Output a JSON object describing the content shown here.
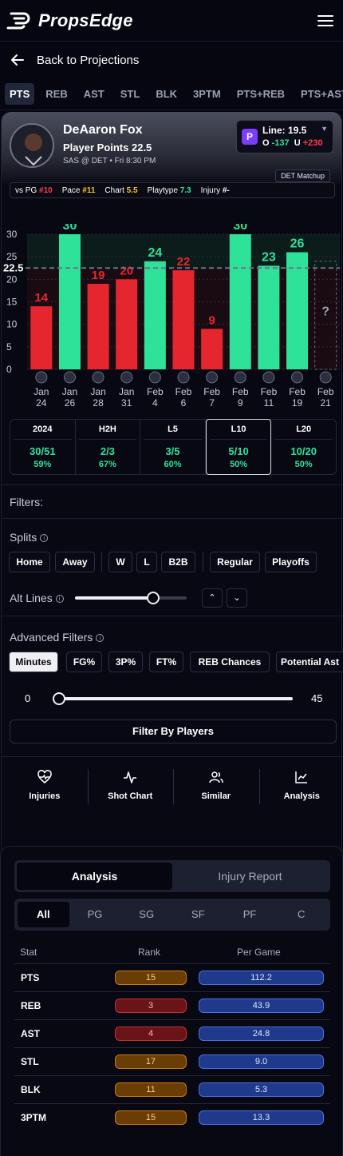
{
  "app": {
    "brand": "PropsEdge"
  },
  "nav": {
    "back_label": "Back to Projections"
  },
  "stat_tabs": [
    "PTS",
    "REB",
    "AST",
    "STL",
    "BLK",
    "3PTM",
    "PTS+REB",
    "PTS+AST"
  ],
  "player": {
    "name": "DeAaron Fox",
    "prop": "Player Points 22.5",
    "game": "SAS @ DET  •  Fri 8:30 PM",
    "line_label": "Line: 19.5",
    "over_label": "O",
    "over_odds": "-137",
    "under_label": "U",
    "under_odds": "+230",
    "matchup_badge": "DET Matchup",
    "book_letter": "P"
  },
  "strip": {
    "vs_pg_label": "vs PG",
    "vs_pg_value": "#10",
    "pace_label": "Pace",
    "pace_value": "#11",
    "chart_label": "Chart",
    "chart_value": "5.5",
    "playtype_label": "Playtype",
    "playtype_value": "7.3",
    "injury_label": "Injury",
    "injury_value": "#-"
  },
  "chart_data": {
    "type": "bar",
    "categories": [
      "Jan 24",
      "Jan 26",
      "Jan 28",
      "Jan 31",
      "Feb 4",
      "Feb 6",
      "Feb 7",
      "Feb 9",
      "Feb 11",
      "Feb 19",
      "Feb 21"
    ],
    "values": [
      14,
      30,
      19,
      20,
      24,
      22,
      9,
      30,
      23,
      26,
      null
    ],
    "upcoming_label": "?",
    "line_label": "22.5",
    "line": 22.5,
    "yticks": [
      0,
      5,
      10,
      15,
      20,
      25,
      30
    ],
    "ylim": [
      0,
      30
    ],
    "over_color": "#2ee29a",
    "under_color": "#e5262f",
    "team_icons": [
      "knicks",
      "nets",
      "76ers",
      "thunder",
      "hawks",
      "hornets",
      "magic",
      "wizards",
      "celtics",
      "suns",
      "pistons"
    ]
  },
  "summary": [
    {
      "head": "2024",
      "value": "30/51",
      "pct": "59%"
    },
    {
      "head": "H2H",
      "value": "2/3",
      "pct": "67%"
    },
    {
      "head": "L5",
      "value": "3/5",
      "pct": "60%"
    },
    {
      "head": "L10",
      "value": "5/10",
      "pct": "50%"
    },
    {
      "head": "L20",
      "value": "10/20",
      "pct": "50%"
    }
  ],
  "filters": {
    "title": "Filters:",
    "splits_label": "Splits",
    "splits": [
      "Home",
      "Away",
      "W",
      "L",
      "B2B",
      "Regular",
      "Playoffs"
    ],
    "alt_lines_label": "Alt Lines",
    "alt_line_value": 0.7,
    "advanced_label": "Advanced Filters",
    "advanced": [
      "Minutes",
      "FG%",
      "3P%",
      "FT%",
      "REB Chances",
      "Potential Ast"
    ],
    "min_label": "0",
    "max_label": "45",
    "filter_players_label": "Filter By Players"
  },
  "tools": [
    "Injuries",
    "Shot Chart",
    "Similar",
    "Analysis"
  ],
  "analysis": {
    "tabs": [
      "Analysis",
      "Injury Report"
    ],
    "positions": [
      "All",
      "PG",
      "SG",
      "SF",
      "PF",
      "C"
    ],
    "headers": [
      "Stat",
      "Rank",
      "Per Game"
    ],
    "rows": [
      {
        "stat": "PTS",
        "rank": "15",
        "per_game": "112.2",
        "level": "mid"
      },
      {
        "stat": "REB",
        "rank": "3",
        "per_game": "43.9",
        "level": "high"
      },
      {
        "stat": "AST",
        "rank": "4",
        "per_game": "24.8",
        "level": "high"
      },
      {
        "stat": "STL",
        "rank": "17",
        "per_game": "9.0",
        "level": "mid"
      },
      {
        "stat": "BLK",
        "rank": "11",
        "per_game": "5.3",
        "level": "mid"
      },
      {
        "stat": "3PTM",
        "rank": "15",
        "per_game": "13.3",
        "level": "mid"
      }
    ]
  }
}
